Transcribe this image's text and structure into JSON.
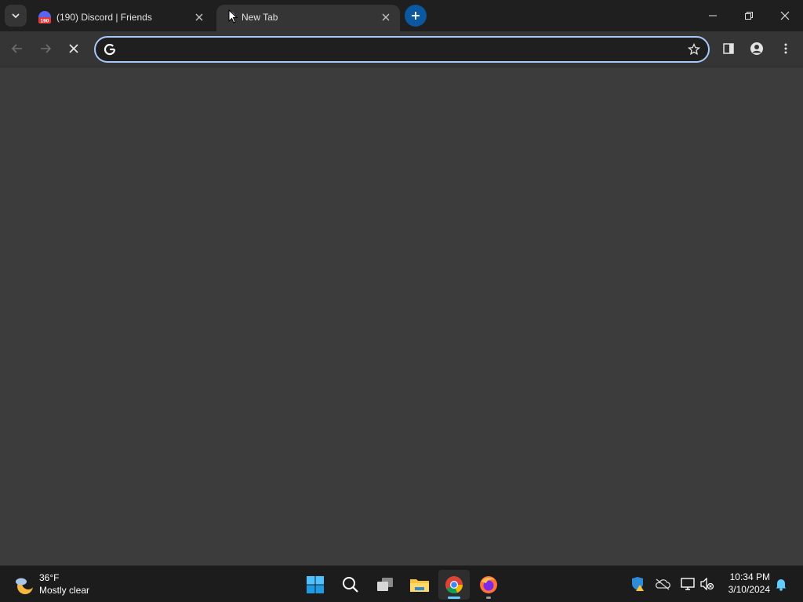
{
  "browser": {
    "tabs": [
      {
        "title": "(190) Discord | Friends",
        "badge": "190",
        "active": false
      },
      {
        "title": "New Tab",
        "active": true
      }
    ],
    "omnibox": {
      "value": "",
      "placeholder": ""
    },
    "accent_color": "#a8c7fa",
    "new_tab_button_color": "#0b57a0"
  },
  "taskbar": {
    "weather": {
      "temperature": "36°F",
      "condition": "Mostly clear"
    },
    "apps": [
      "start-icon",
      "search-icon",
      "task-view-icon",
      "file-explorer-icon",
      "chrome-icon",
      "firefox-icon"
    ],
    "clock": {
      "time": "10:34 PM",
      "date": "3/10/2024"
    }
  }
}
